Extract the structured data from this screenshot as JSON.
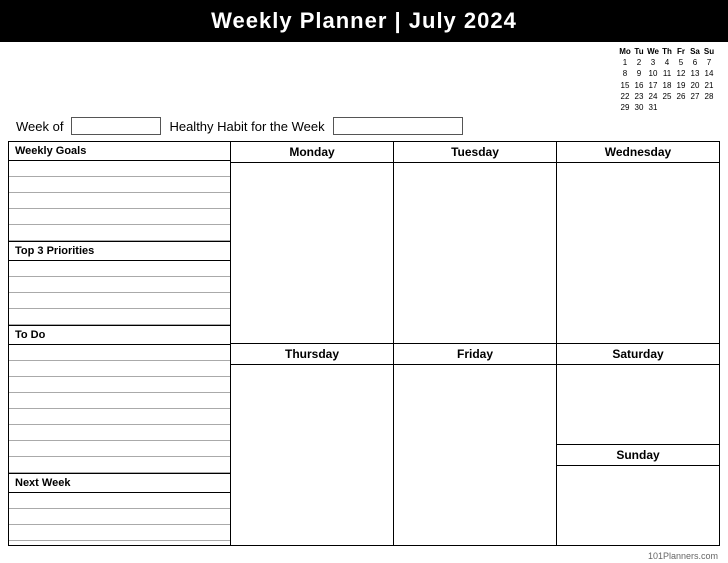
{
  "header": {
    "title": "Weekly Planner | July 2024"
  },
  "weekRow": {
    "weekOfLabel": "Week of",
    "habitLabel": "Healthy Habit for the Week"
  },
  "miniCalendar": {
    "headers": [
      "Mo",
      "Tu",
      "We",
      "Th",
      "Fr",
      "Sa",
      "Su"
    ],
    "rows": [
      [
        "1",
        "2",
        "3",
        "4",
        "5",
        "6",
        "7"
      ],
      [
        "8",
        "9",
        "10",
        "11",
        "12",
        "13",
        "14"
      ],
      [
        "15",
        "16",
        "17",
        "18",
        "19",
        "20",
        "21"
      ],
      [
        "22",
        "23",
        "24",
        "25",
        "26",
        "27",
        "28"
      ],
      [
        "29",
        "30",
        "31",
        "",
        "",
        "",
        ""
      ]
    ]
  },
  "leftPanel": {
    "weeklyGoalsLabel": "Weekly Goals",
    "top3Label": "Top 3 Priorities",
    "todoLabel": "To Do",
    "nextWeekLabel": "Next Week",
    "goalLines": 5,
    "top3Lines": 4,
    "todoLines": 8,
    "nextWeekLines": 4
  },
  "days": {
    "monday": "Monday",
    "tuesday": "Tuesday",
    "wednesday": "Wednesday",
    "thursday": "Thursday",
    "friday": "Friday",
    "saturday": "Saturday",
    "sunday": "Sunday"
  },
  "footer": {
    "text": "101Planners.com"
  }
}
